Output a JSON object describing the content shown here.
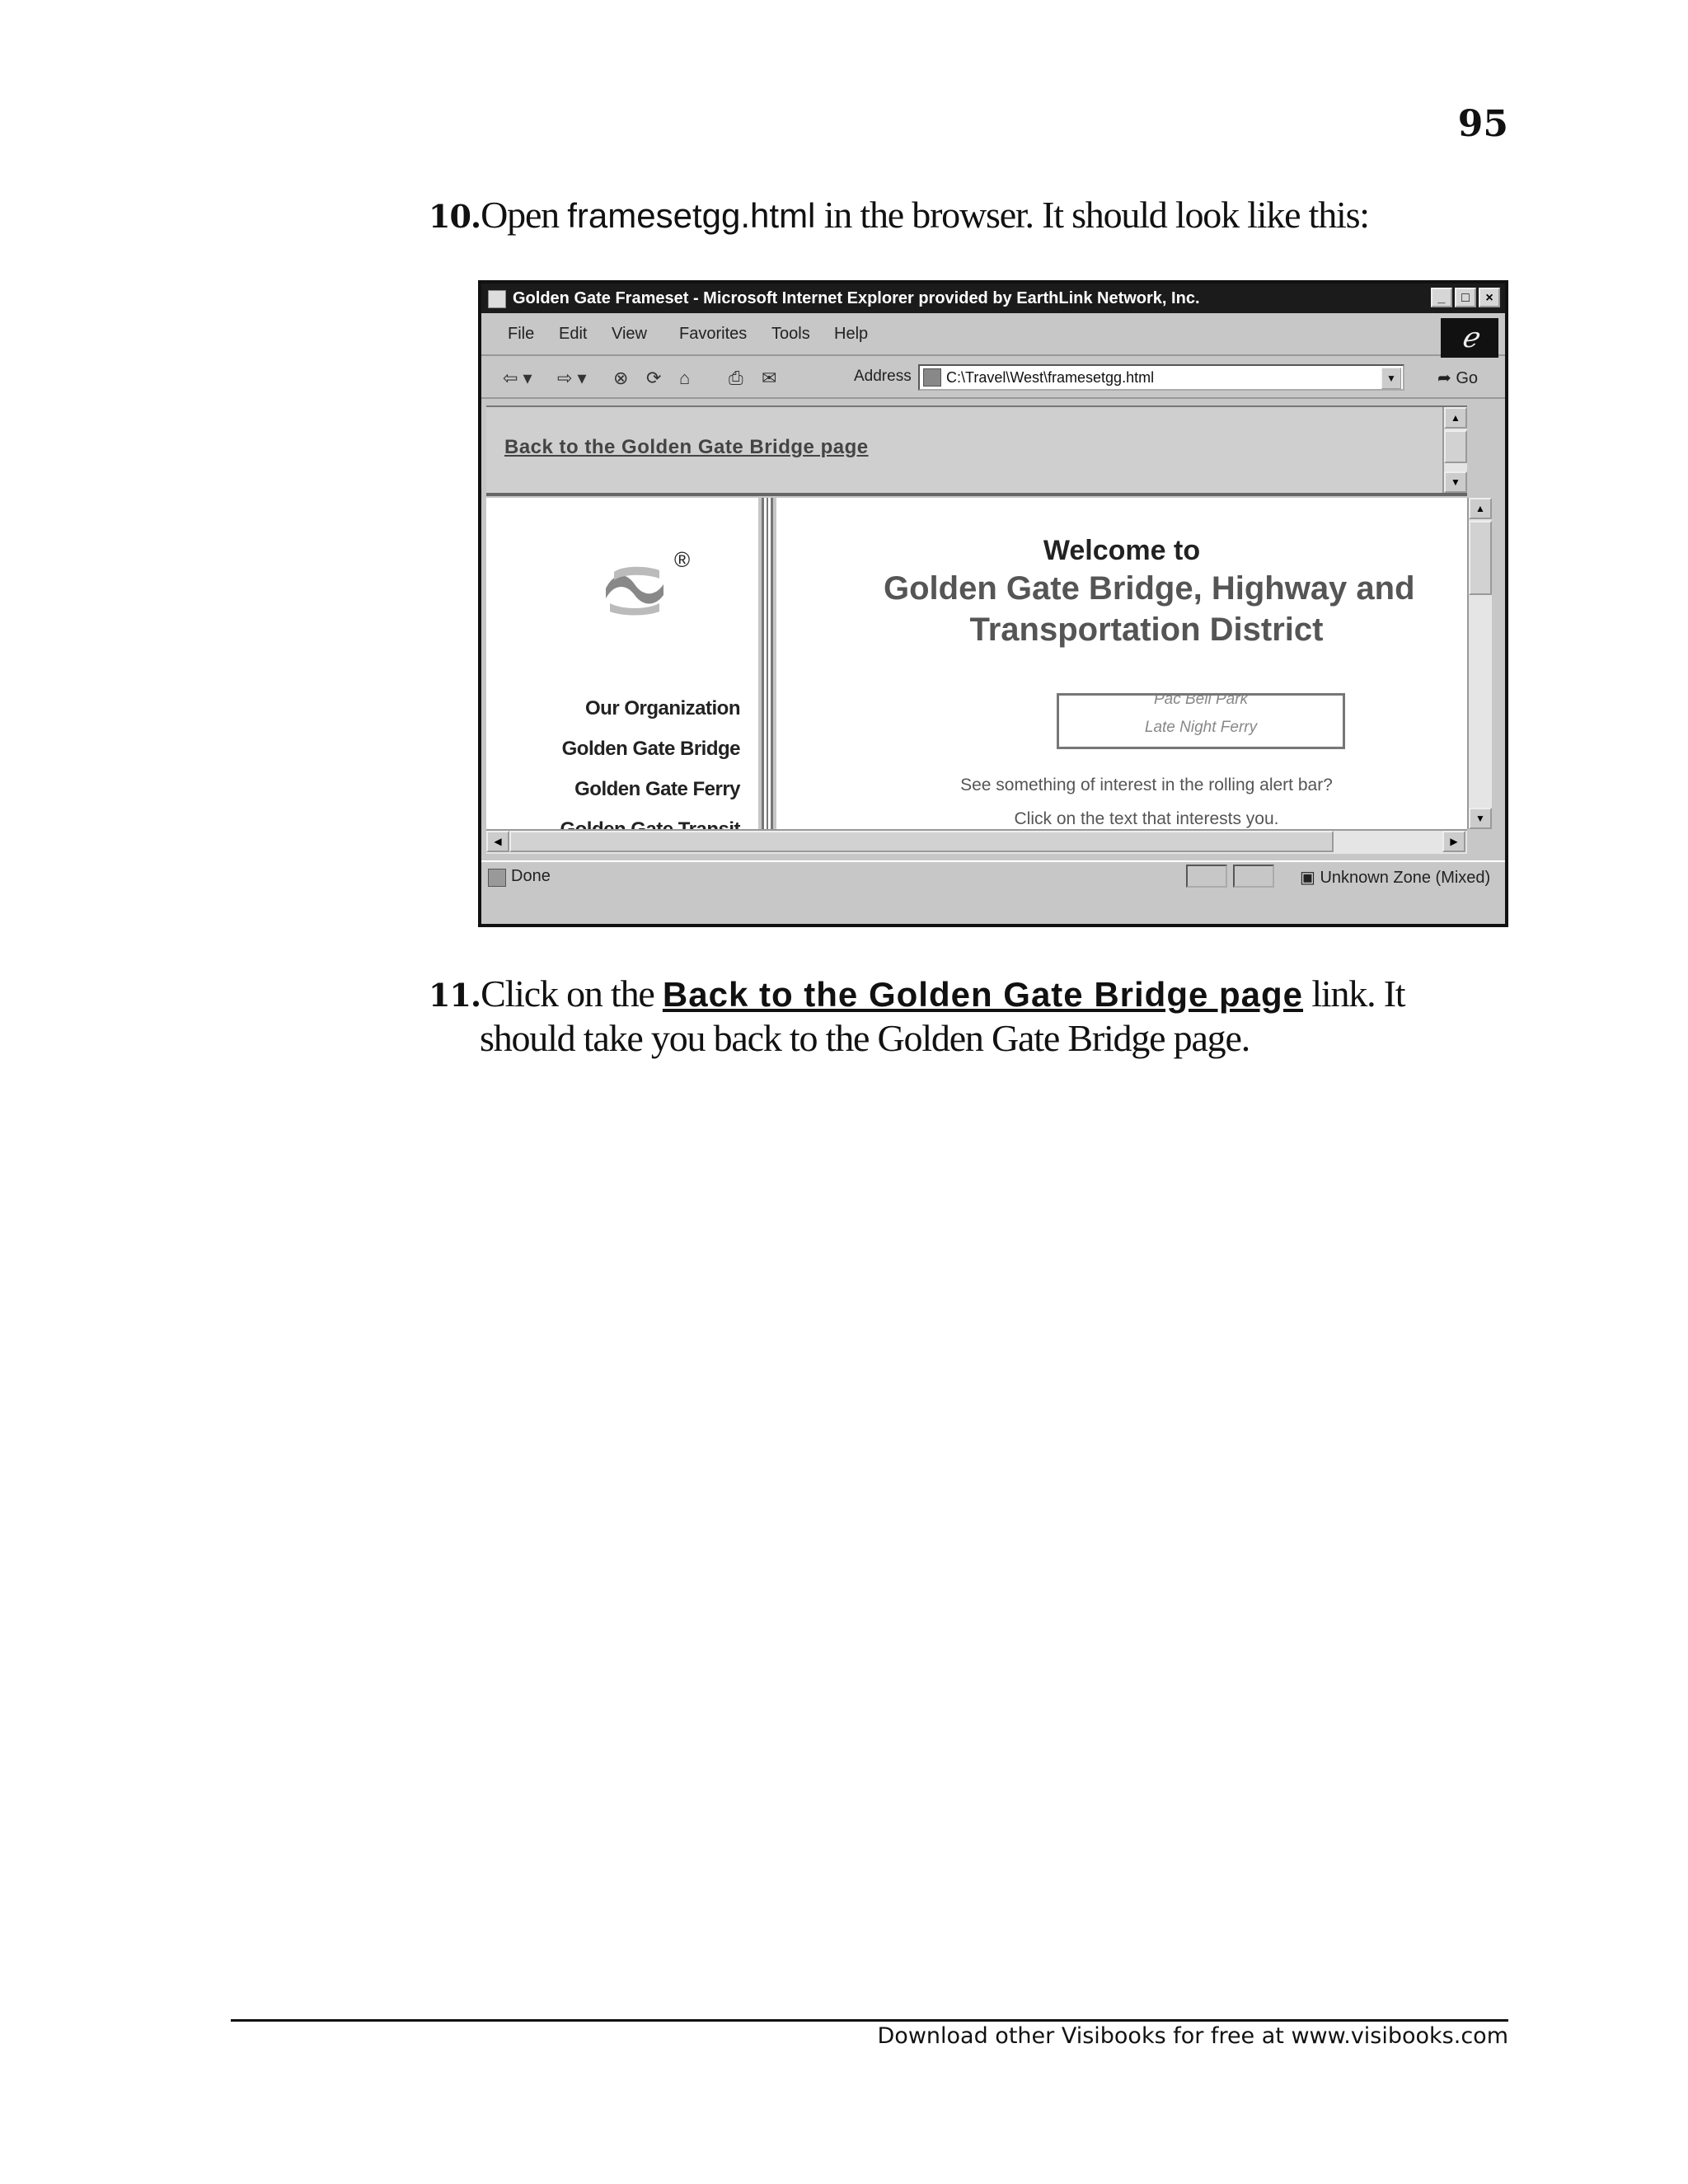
{
  "page": {
    "number": "95"
  },
  "step10": {
    "num": "10.",
    "before": "Open ",
    "file": "framesetgg.html",
    "after": " in the browser. It should look like this:"
  },
  "browser": {
    "title": "Golden Gate Frameset - Microsoft Internet Explorer provided by EarthLink Network, Inc.",
    "menus": [
      "File",
      "Edit",
      "View",
      "Favorites",
      "Tools",
      "Help"
    ],
    "address_label": "Address",
    "address_value": "C:\\Travel\\West\\framesetgg.html",
    "go_label": "Go",
    "top_frame_link": "Back to the Golden Gate Bridge page",
    "nav": [
      "Our Organization",
      "Golden Gate Bridge",
      "Golden Gate Ferry",
      "Golden Gate Transit"
    ],
    "welcome": "Welcome to",
    "headline1": "Golden Gate Bridge, Highway and",
    "headline2": "Transportation District",
    "ticker": [
      "Pac Bell Park",
      "Late Night Ferry"
    ],
    "alert1": "See something of interest in the rolling alert bar?",
    "alert2": "Click on the text that interests you.",
    "status": "Done",
    "zone": "Unknown Zone (Mixed)"
  },
  "step11": {
    "num": "11.",
    "before": "Click on the ",
    "link": "Back to the Golden Gate Bridge page",
    "after": " link. It",
    "line2": "should take you back to the Golden Gate Bridge page."
  },
  "footer": {
    "text": "Download other Visibooks for free at www.visibooks.com"
  }
}
